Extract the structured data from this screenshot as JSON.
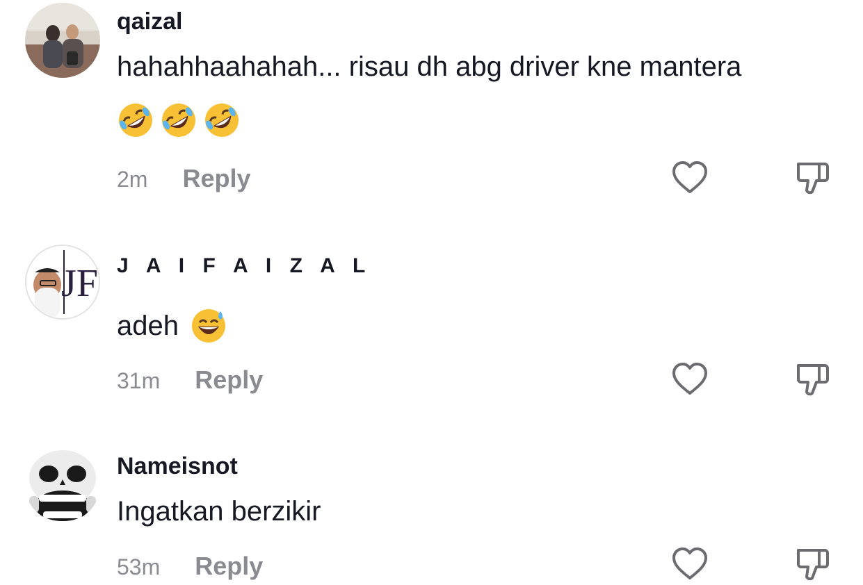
{
  "comments": [
    {
      "username": "qaizal",
      "text": "hahahhaahahah... risau dh abg driver kne mantera",
      "emoji_row": [
        "rolling-on-floor-laughing-emoji",
        "rolling-on-floor-laughing-emoji",
        "rolling-on-floor-laughing-emoji"
      ],
      "time": "2m",
      "reply_label": "Reply"
    },
    {
      "username": "J A I F A I Z A L",
      "text": "adeh",
      "inline_emoji": "grinning-face-with-sweat-emoji",
      "time": "31m",
      "reply_label": "Reply"
    },
    {
      "username": "Nameisnot",
      "text": "Ingatkan berzikir",
      "time": "53m",
      "reply_label": "Reply"
    }
  ],
  "colors": {
    "text": "#161823",
    "muted": "#8a8b91",
    "icon": "#6b6b70",
    "emoji": "#f7c035"
  },
  "icons": [
    "heart-icon",
    "thumbs-down-icon"
  ]
}
